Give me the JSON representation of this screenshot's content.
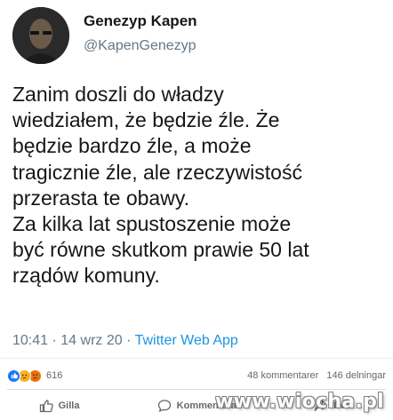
{
  "tweet": {
    "author_name": "Genezyp Kapen",
    "author_handle": "@KapenGenezyp",
    "text_lines": [
      "Zanim doszli do władzy",
      "wiedziałem, że będzie źle. Że",
      "będzie bardzo źle, a może",
      "tragicznie źle, ale rzeczywistość",
      "przerasta te obawy.",
      "Za kilka lat spustoszenie może",
      "być równe skutkom prawie 50 lat",
      "rządów komuny."
    ],
    "time": "10:41",
    "date": "14 wrz 20",
    "separator": "·",
    "source": "Twitter Web App"
  },
  "facebook": {
    "reaction_count": "616",
    "comments": "48 kommentarer",
    "shares": "146 delningar",
    "actions": {
      "like": "Gilla",
      "comment": "Kommentera",
      "share": "Dela"
    },
    "reaction_icons": [
      "like-icon",
      "sad-icon",
      "angry-icon"
    ]
  },
  "watermark": "www.wiocha.pl",
  "colors": {
    "link": "#1b95e0",
    "muted": "#657786",
    "text": "#14171a",
    "fb_blue": "#1877f2"
  }
}
